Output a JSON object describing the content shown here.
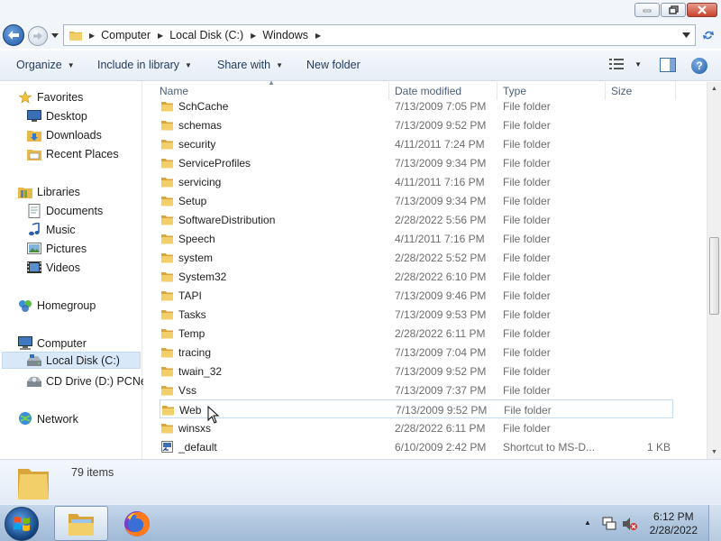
{
  "window": {
    "controls": {
      "minimize_icon": "minimize-icon",
      "maximize_icon": "maximize-icon",
      "close_icon": "close-icon"
    }
  },
  "address": {
    "breadcrumbs": [
      "Computer",
      "Local Disk (C:)",
      "Windows"
    ]
  },
  "toolbar": {
    "organize": "Organize",
    "include_in_library": "Include in library",
    "share_with": "Share with",
    "new_folder": "New folder"
  },
  "nav": {
    "favorites": {
      "label": "Favorites",
      "items": [
        "Desktop",
        "Downloads",
        "Recent Places"
      ]
    },
    "libraries": {
      "label": "Libraries",
      "items": [
        "Documents",
        "Music",
        "Pictures",
        "Videos"
      ]
    },
    "homegroup": "Homegroup",
    "computer": {
      "label": "Computer",
      "items": [
        "Local Disk (C:)",
        "CD Drive (D:) PCNet"
      ]
    },
    "network": "Network"
  },
  "columns": {
    "name": "Name",
    "date": "Date modified",
    "type": "Type",
    "size": "Size"
  },
  "files": [
    {
      "name": "SchCache",
      "date": "7/13/2009 7:05 PM",
      "type": "File folder",
      "size": ""
    },
    {
      "name": "schemas",
      "date": "7/13/2009 9:52 PM",
      "type": "File folder",
      "size": ""
    },
    {
      "name": "security",
      "date": "4/11/2011 7:24 PM",
      "type": "File folder",
      "size": ""
    },
    {
      "name": "ServiceProfiles",
      "date": "7/13/2009 9:34 PM",
      "type": "File folder",
      "size": ""
    },
    {
      "name": "servicing",
      "date": "4/11/2011 7:16 PM",
      "type": "File folder",
      "size": ""
    },
    {
      "name": "Setup",
      "date": "7/13/2009 9:34 PM",
      "type": "File folder",
      "size": ""
    },
    {
      "name": "SoftwareDistribution",
      "date": "2/28/2022 5:56 PM",
      "type": "File folder",
      "size": ""
    },
    {
      "name": "Speech",
      "date": "4/11/2011 7:16 PM",
      "type": "File folder",
      "size": ""
    },
    {
      "name": "system",
      "date": "2/28/2022 5:52 PM",
      "type": "File folder",
      "size": ""
    },
    {
      "name": "System32",
      "date": "2/28/2022 6:10 PM",
      "type": "File folder",
      "size": ""
    },
    {
      "name": "TAPI",
      "date": "7/13/2009 9:46 PM",
      "type": "File folder",
      "size": ""
    },
    {
      "name": "Tasks",
      "date": "7/13/2009 9:53 PM",
      "type": "File folder",
      "size": ""
    },
    {
      "name": "Temp",
      "date": "2/28/2022 6:11 PM",
      "type": "File folder",
      "size": ""
    },
    {
      "name": "tracing",
      "date": "7/13/2009 7:04 PM",
      "type": "File folder",
      "size": ""
    },
    {
      "name": "twain_32",
      "date": "7/13/2009 9:52 PM",
      "type": "File folder",
      "size": ""
    },
    {
      "name": "Vss",
      "date": "7/13/2009 7:37 PM",
      "type": "File folder",
      "size": ""
    },
    {
      "name": "Web",
      "date": "7/13/2009 9:52 PM",
      "type": "File folder",
      "size": ""
    },
    {
      "name": "winsxs",
      "date": "2/28/2022 6:11 PM",
      "type": "File folder",
      "size": ""
    },
    {
      "name": "_default",
      "date": "6/10/2009 2:42 PM",
      "type": "Shortcut to MS-D...",
      "size": "1 KB"
    }
  ],
  "hover_row": "Web",
  "details": {
    "count": "79 items"
  },
  "taskbar": {
    "time": "6:12 PM",
    "date": "2/28/2022",
    "pinned": [
      "windows-explorer-icon",
      "firefox-icon"
    ]
  },
  "colors": {
    "selection": "#d9e8f9",
    "taskbar": "#b3c9e2",
    "folder": "#f0c75a"
  }
}
